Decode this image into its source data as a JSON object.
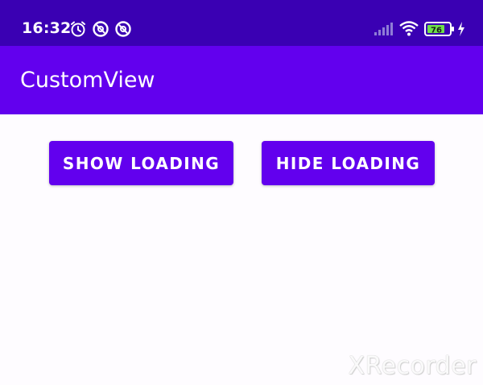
{
  "status_bar": {
    "time": "16:32",
    "battery_level": "76",
    "icons": [
      "alarm-icon",
      "sync-icon",
      "sync-icon",
      "signal-icon",
      "wifi-icon",
      "battery-icon",
      "charging-icon"
    ]
  },
  "app_bar": {
    "title": "CustomView"
  },
  "buttons": {
    "show_loading": "SHOW LOADING",
    "hide_loading": "HIDE LOADING"
  },
  "watermark": "XRecorder",
  "colors": {
    "primary": "#6200ee",
    "primary_dark": "#3a00b3",
    "background": "#fefcff",
    "battery_fill": "#6ee04a"
  }
}
